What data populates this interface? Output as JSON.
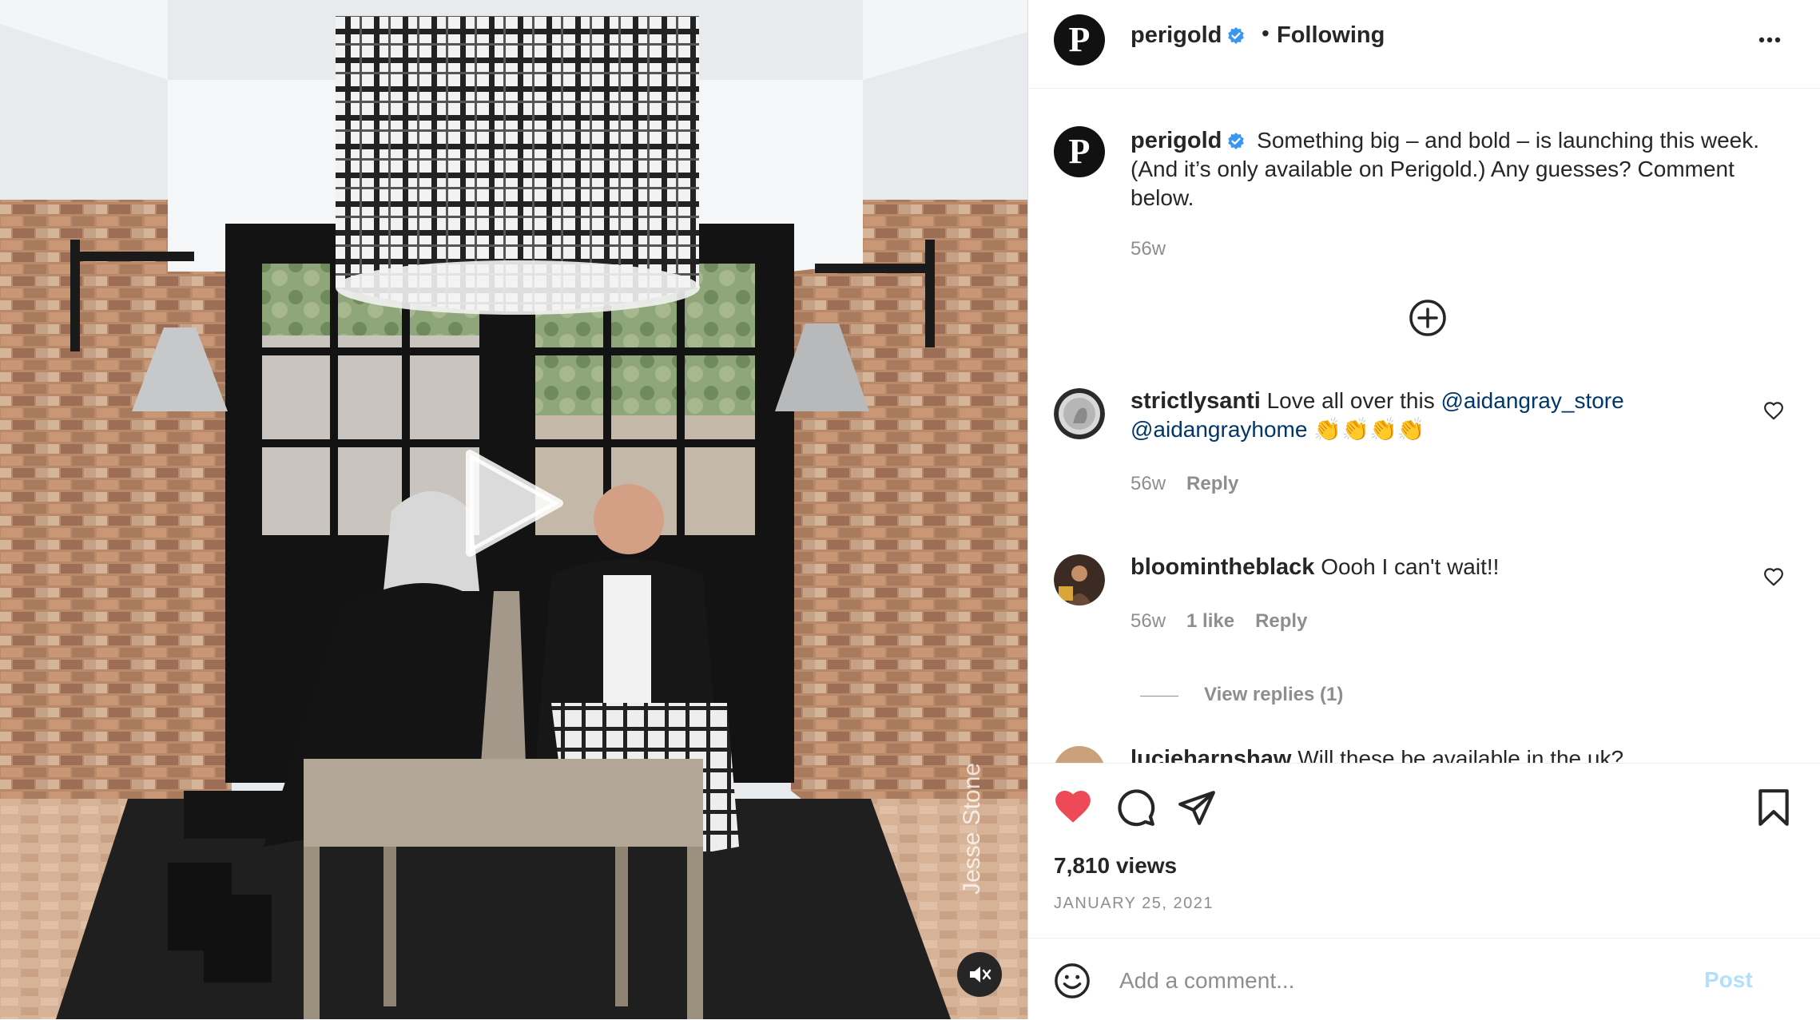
{
  "post": {
    "account": "perigold",
    "avatar_letter": "P",
    "header_dot": "•",
    "follow_status": "Following",
    "caption": "Something big – and bold – is launching this week. (And it’s only available on Perigold.) Any guesses? Comment below.",
    "caption_age": "56w",
    "photo_credit": "Jesse Stone"
  },
  "comments": [
    {
      "user": "strictlysanti",
      "text_before": "Love all over this ",
      "mention_1": "@aidangray_store",
      "mention_2": "@aidangrayhome",
      "emoji": "👏👏👏👏",
      "age": "56w",
      "reply_label": "Reply"
    },
    {
      "user": "bloomintheblack",
      "text": "Oooh I can't wait!!",
      "age": "56w",
      "likes": "1 like",
      "reply_label": "Reply",
      "view_replies": "View replies (1)"
    },
    {
      "user": "lucieharnshaw",
      "text": "Will these be available in the uk?"
    }
  ],
  "stats": {
    "views": "7,810 views",
    "date": "JANUARY 25, 2021"
  },
  "composer": {
    "placeholder": "Add a comment...",
    "post_label": "Post"
  },
  "colors": {
    "liked_heart": "#ed4956",
    "verified_badge": "#3897f0",
    "mention": "#00376b",
    "post_disabled": "#b2dffc"
  },
  "icons": [
    "verified-badge-icon",
    "more-options-icon",
    "load-more-icon",
    "heart-icon",
    "comment-icon",
    "share-icon",
    "bookmark-icon",
    "emoji-icon",
    "play-icon",
    "mute-icon"
  ]
}
